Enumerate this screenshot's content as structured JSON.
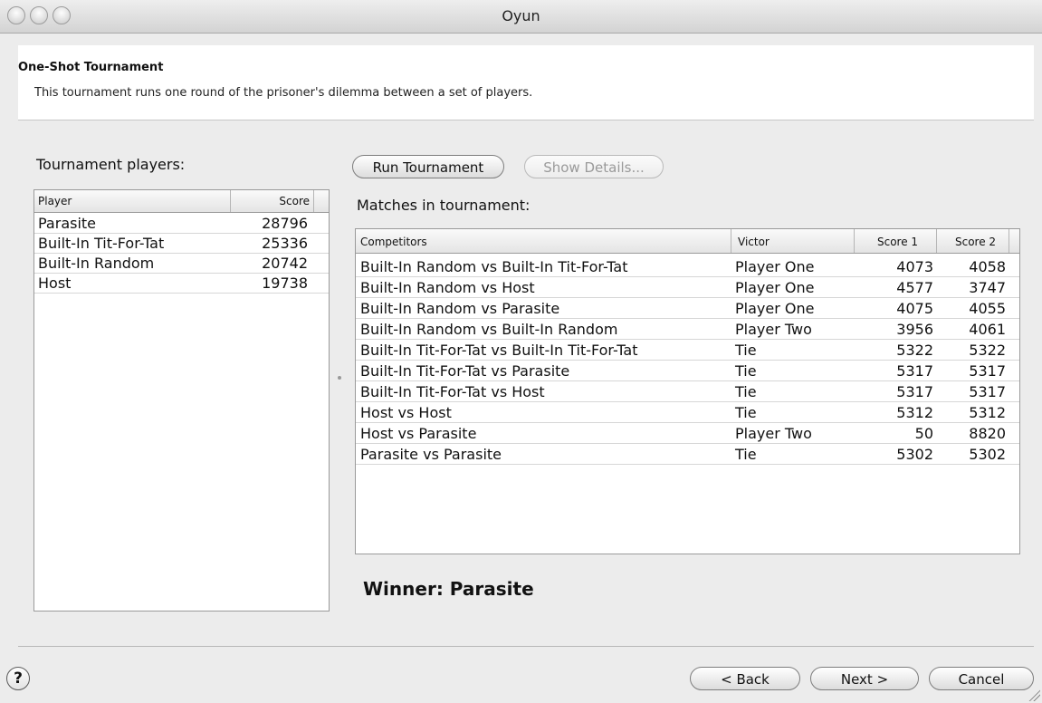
{
  "window": {
    "title": "Oyun"
  },
  "banner": {
    "title": "One-Shot Tournament",
    "description": "This tournament runs one round of the prisoner's dilemma between a set of players."
  },
  "players": {
    "label": "Tournament players:",
    "columns": [
      "Player",
      "Score"
    ],
    "rows": [
      {
        "player": "Parasite",
        "score": "28796"
      },
      {
        "player": "Built-In Tit-For-Tat",
        "score": "25336"
      },
      {
        "player": "Built-In Random",
        "score": "20742"
      },
      {
        "player": "Host",
        "score": "19738"
      }
    ]
  },
  "actions": {
    "run": "Run Tournament",
    "details": "Show Details..."
  },
  "matches": {
    "label": "Matches in tournament:",
    "columns": [
      "Competitors",
      "Victor",
      "Score 1",
      "Score 2"
    ],
    "rows": [
      {
        "competitors": "Built-In Random vs Built-In Tit-For-Tat",
        "victor": "Player One",
        "score1": "4073",
        "score2": "4058"
      },
      {
        "competitors": "Built-In Random vs Host",
        "victor": "Player One",
        "score1": "4577",
        "score2": "3747"
      },
      {
        "competitors": "Built-In Random vs Parasite",
        "victor": "Player One",
        "score1": "4075",
        "score2": "4055"
      },
      {
        "competitors": "Built-In Random vs Built-In Random",
        "victor": "Player Two",
        "score1": "3956",
        "score2": "4061"
      },
      {
        "competitors": "Built-In Tit-For-Tat vs Built-In Tit-For-Tat",
        "victor": "Tie",
        "score1": "5322",
        "score2": "5322"
      },
      {
        "competitors": "Built-In Tit-For-Tat vs Parasite",
        "victor": "Tie",
        "score1": "5317",
        "score2": "5317"
      },
      {
        "competitors": "Built-In Tit-For-Tat vs Host",
        "victor": "Tie",
        "score1": "5317",
        "score2": "5317"
      },
      {
        "competitors": "Host vs Host",
        "victor": "Tie",
        "score1": "5312",
        "score2": "5312"
      },
      {
        "competitors": "Host vs Parasite",
        "victor": "Player Two",
        "score1": "50",
        "score2": "8820"
      },
      {
        "competitors": "Parasite vs Parasite",
        "victor": "Tie",
        "score1": "5302",
        "score2": "5302"
      }
    ]
  },
  "winner": "Winner: Parasite",
  "footer": {
    "help": "?",
    "back": "< Back",
    "next": "Next >",
    "cancel": "Cancel"
  },
  "icons": [
    "close-icon",
    "minimize-icon",
    "zoom-icon",
    "help-icon",
    "resize-grip-icon"
  ]
}
